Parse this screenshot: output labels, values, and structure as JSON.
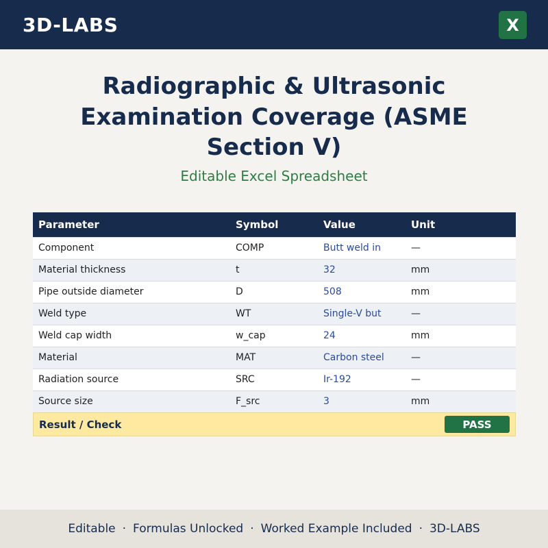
{
  "header": {
    "brand": "3D-LABS",
    "excel_icon_glyph": "X",
    "excel_icon_name": "excel-icon",
    "bg_color": "#172b4d",
    "excel_color": "#217346"
  },
  "main": {
    "title": "Radiographic & Ultrasonic Examination Coverage (ASME Section V)",
    "subtitle": "Editable Excel Spreadsheet"
  },
  "table": {
    "columns": [
      "Parameter",
      "Symbol",
      "Value",
      "Unit"
    ],
    "rows": [
      {
        "parameter": "Component",
        "symbol": "COMP",
        "value": "Butt weld in",
        "unit": "—"
      },
      {
        "parameter": "Material thickness",
        "symbol": "t",
        "value": "32",
        "unit": "mm"
      },
      {
        "parameter": "Pipe outside diameter",
        "symbol": "D",
        "value": "508",
        "unit": "mm"
      },
      {
        "parameter": "Weld type",
        "symbol": "WT",
        "value": "Single-V but",
        "unit": "—"
      },
      {
        "parameter": "Weld cap width",
        "symbol": "w_cap",
        "value": "24",
        "unit": "mm"
      },
      {
        "parameter": "Material",
        "symbol": "MAT",
        "value": "Carbon steel",
        "unit": "—"
      },
      {
        "parameter": "Radiation source",
        "symbol": "SRC",
        "value": "Ir-192",
        "unit": "—"
      },
      {
        "parameter": "Source size",
        "symbol": "F_src",
        "value": "3",
        "unit": "mm"
      }
    ],
    "result_label": "Result / Check",
    "result_status": "PASS"
  },
  "footer": {
    "items": [
      "Editable",
      "Formulas Unlocked",
      "Worked Example Included",
      "3D-LABS"
    ],
    "separator": "·"
  }
}
